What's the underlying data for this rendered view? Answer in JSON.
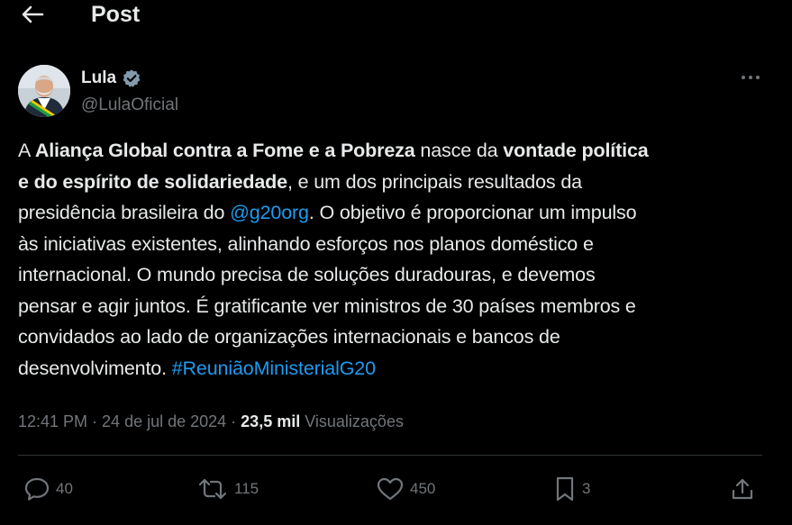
{
  "header": {
    "back_icon": "arrow-left-icon",
    "title": "Post"
  },
  "author": {
    "name": "Lula",
    "handle": "@LulaOficial",
    "verified_icon": "verified-badge-icon",
    "more_icon": "more-horizontal-icon"
  },
  "post": {
    "segments": [
      {
        "text": "A ",
        "style": "normal"
      },
      {
        "text": "Aliança Global contra a Fome e a Pobreza",
        "style": "bold"
      },
      {
        "text": " nasce da ",
        "style": "normal"
      },
      {
        "text": "vontade política",
        "style": "bold"
      },
      {
        "text": "e do espírito de solidariedade",
        "style": "bold"
      },
      {
        "text": ", e um dos principais resultados da",
        "style": "normal"
      },
      {
        "text": "presidência brasileira do ",
        "style": "normal"
      },
      {
        "text": "@g20org",
        "style": "link"
      },
      {
        "text": ". O objetivo é proporcionar um impulso",
        "style": "normal"
      },
      {
        "text": "às iniciativas existentes, alinhando esforços nos planos doméstico e",
        "style": "normal"
      },
      {
        "text": "internacional. O mundo precisa de soluções duradouras, e devemos",
        "style": "normal"
      },
      {
        "text": "pensar e agir juntos. É gratificante ver ministros de 30 países membros e",
        "style": "normal"
      },
      {
        "text": "convidados ao lado de organizações internacionais e bancos de",
        "style": "normal"
      },
      {
        "text": "desenvolvimento. ",
        "style": "normal"
      },
      {
        "text": "#ReuniãoMinisterialG20",
        "style": "link"
      }
    ]
  },
  "meta": {
    "time": "12:41 PM",
    "separator": " · ",
    "date": "24 de jul de 2024",
    "views_count": "23,5 mil",
    "views_label": " Visualizações"
  },
  "actions": {
    "replies": {
      "icon": "reply-icon",
      "count": "40"
    },
    "reposts": {
      "icon": "repost-icon",
      "count": "115"
    },
    "likes": {
      "icon": "heart-icon",
      "count": "450"
    },
    "bookmarks": {
      "icon": "bookmark-icon",
      "count": "3"
    },
    "share": {
      "icon": "share-icon"
    }
  },
  "colors": {
    "background": "#000000",
    "text": "#e7e9ea",
    "muted": "#71767b",
    "link": "#1d9bf0",
    "divider": "#2f3336",
    "verified_badge": "#829aab"
  }
}
